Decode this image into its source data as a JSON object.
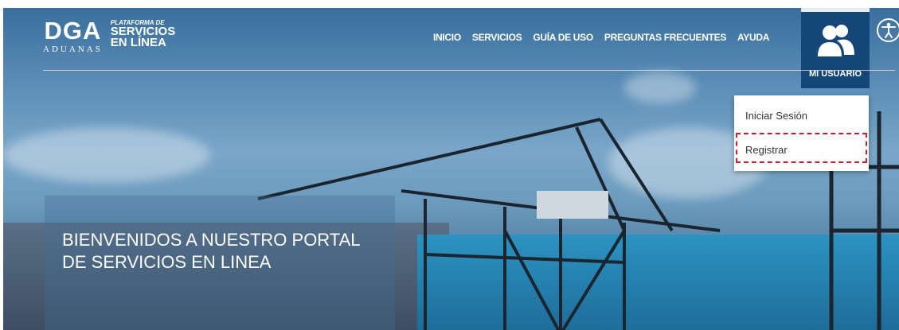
{
  "logo": {
    "mark": "DGA",
    "subtitle": "ADUANAS",
    "tagline_small": "PLATAFORMA DE",
    "tagline_line1": "SERVICIOS",
    "tagline_line2": "EN LÍNEA"
  },
  "nav": {
    "items": [
      {
        "label": "INICIO"
      },
      {
        "label": "SERVICIOS"
      },
      {
        "label": "GUÍA DE USO"
      },
      {
        "label": "PREGUNTAS FRECUENTES"
      },
      {
        "label": "AYUDA"
      }
    ]
  },
  "user_menu": {
    "label": "MI USUARIO",
    "icon": "users-icon",
    "items": [
      {
        "label": "Iniciar Sesión"
      },
      {
        "label": "Registrar"
      }
    ]
  },
  "accessibility": {
    "icon": "accessibility-icon"
  },
  "hero": {
    "line1": "BIENVENIDOS A NUESTRO PORTAL",
    "line2": "DE SERVICIOS EN LINEA"
  },
  "colors": {
    "user_button": "#15467a",
    "highlight": "#c8202e"
  }
}
